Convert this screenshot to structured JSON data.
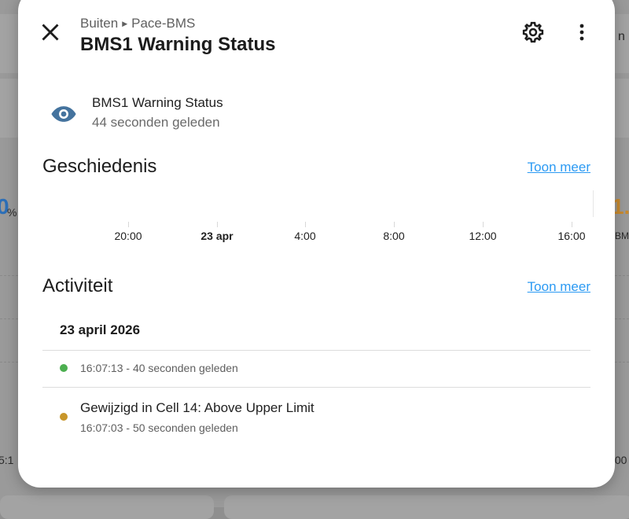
{
  "background": {
    "left_value": "0",
    "left_unit": "%",
    "right_value": "1.",
    "right_label": "BMS",
    "right_header": "n",
    "left_time": "5:1",
    "right_time": ":00"
  },
  "dialog": {
    "breadcrumb": [
      "Buiten",
      "Pace-BMS"
    ],
    "title": "BMS1 Warning Status",
    "entity": {
      "name": "BMS1 Warning Status",
      "last_changed": "44 seconden geleden",
      "icon": "eye-icon",
      "icon_color": "#44739e"
    },
    "history": {
      "title": "Geschiedenis",
      "more_link": "Toon meer",
      "axis_labels": [
        "20:00",
        "23 apr",
        "4:00",
        "8:00",
        "12:00",
        "16:00"
      ]
    },
    "activity": {
      "title": "Activiteit",
      "more_link": "Toon meer",
      "date": "23 april 2026",
      "events": [
        {
          "message": "",
          "time": "16:07:13 - 40 seconden geleden",
          "dot_color": "#4caf50"
        },
        {
          "message": "Gewijzigd in Cell 14: Above Upper Limit",
          "time": "16:07:03 - 50 seconden geleden",
          "dot_color": "#c8962a"
        }
      ]
    }
  },
  "colors": {
    "link": "#2b9af3",
    "left_value": "#2c6fb8",
    "right_value": "#c98a2e"
  }
}
